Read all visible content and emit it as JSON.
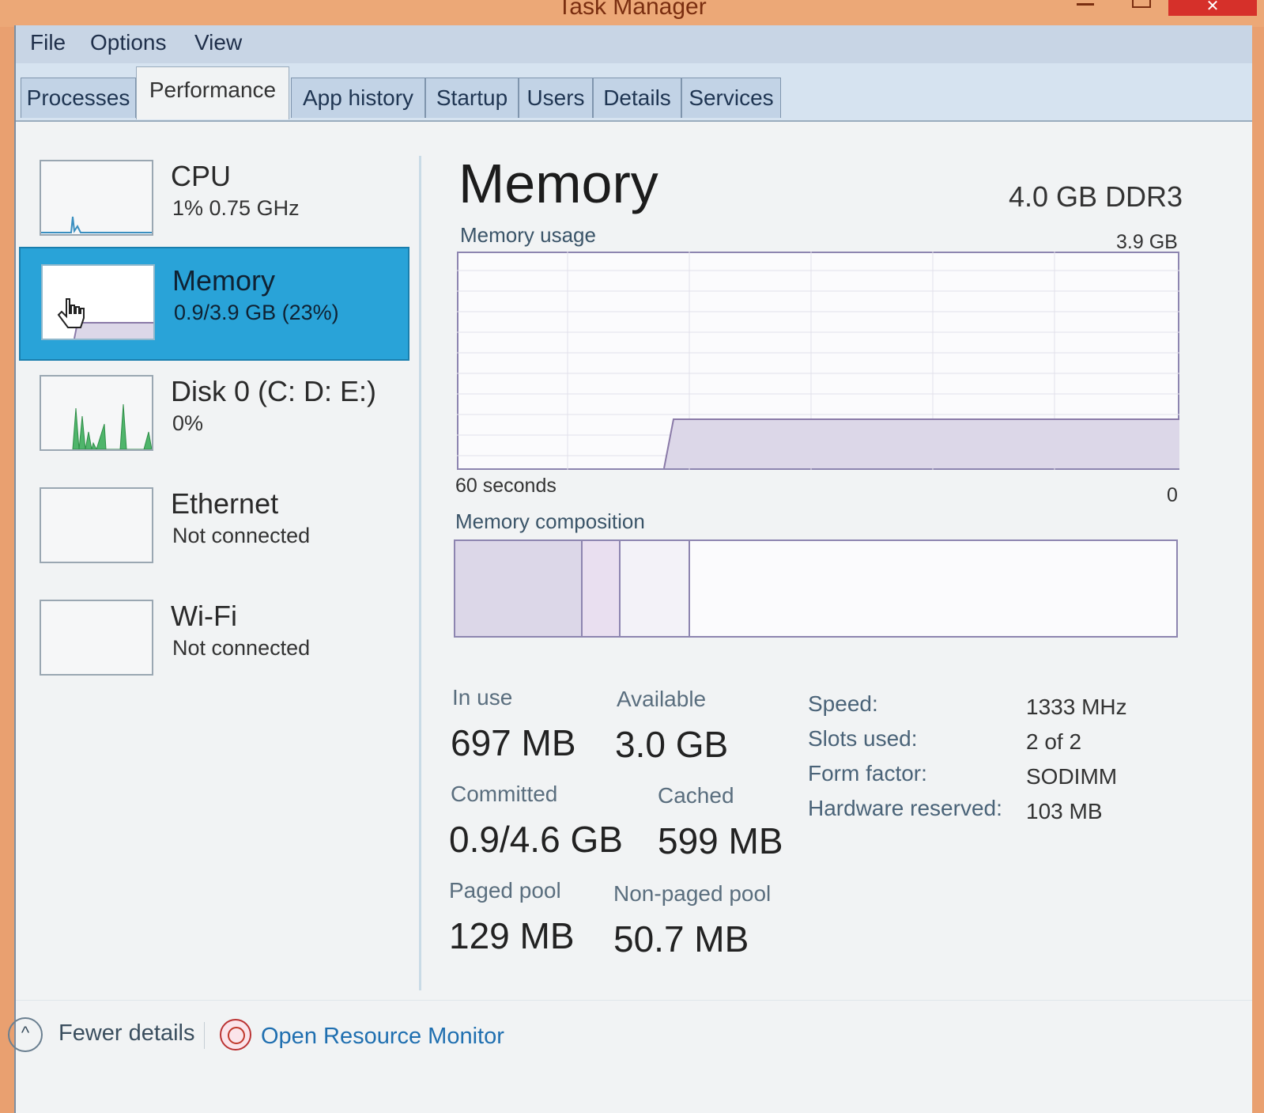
{
  "window": {
    "title": "Task Manager"
  },
  "menu": [
    "File",
    "Options",
    "View"
  ],
  "tabs": [
    "Processes",
    "Performance",
    "App history",
    "Startup",
    "Users",
    "Details",
    "Services"
  ],
  "active_tab": "Performance",
  "sidebar": [
    {
      "title": "CPU",
      "subtitle": "1% 0.75 GHz"
    },
    {
      "title": "Memory",
      "subtitle": "0.9/3.9 GB (23%)",
      "selected": true
    },
    {
      "title": "Disk 0 (C: D: E:)",
      "subtitle": "0%"
    },
    {
      "title": "Ethernet",
      "subtitle": "Not connected"
    },
    {
      "title": "Wi-Fi",
      "subtitle": "Not connected"
    }
  ],
  "main": {
    "title": "Memory",
    "spec": "4.0 GB DDR3",
    "usage_label": "Memory usage",
    "usage_max": "3.9 GB",
    "time_left": "60 seconds",
    "time_right": "0",
    "composition_label": "Memory composition",
    "stats": {
      "in_use_label": "In use",
      "in_use_value": "697 MB",
      "available_label": "Available",
      "available_value": "3.0 GB",
      "committed_label": "Committed",
      "committed_value": "0.9/4.6 GB",
      "cached_label": "Cached",
      "cached_value": "599 MB",
      "paged_label": "Paged pool",
      "paged_value": "129 MB",
      "nonpaged_label": "Non-paged pool",
      "nonpaged_value": "50.7 MB"
    },
    "specs": [
      {
        "label": "Speed:",
        "value": "1333 MHz"
      },
      {
        "label": "Slots used:",
        "value": "2 of 2"
      },
      {
        "label": "Form factor:",
        "value": "SODIMM"
      },
      {
        "label": "Hardware reserved:",
        "value": "103 MB"
      }
    ]
  },
  "footer": {
    "fewer_details": "Fewer details",
    "open_monitor": "Open Resource Monitor"
  },
  "colors": {
    "accent": "#29a3d8",
    "graph_line": "#8a7aa8",
    "graph_fill": "#dcd7e8",
    "link": "#1f6fb0"
  }
}
